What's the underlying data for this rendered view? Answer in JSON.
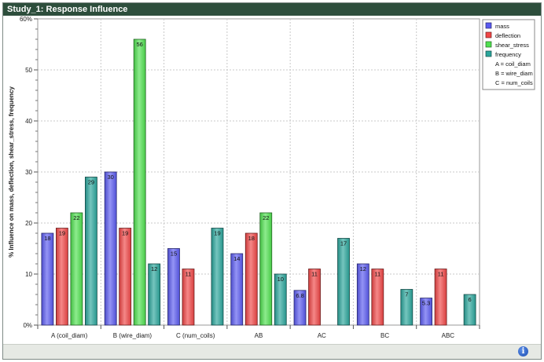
{
  "window": {
    "title": "Study_1: Response Influence"
  },
  "status": {
    "info_icon": "info-icon",
    "info_glyph": "i"
  },
  "chart_data": {
    "type": "bar",
    "title": "",
    "xlabel": "",
    "ylabel": "% Influence on mass, deflection, shear_stress, frequency",
    "ylim": [
      0,
      60
    ],
    "yticks": [
      "0%",
      "10",
      "20",
      "30",
      "40",
      "50",
      "60%"
    ],
    "yticks_values": [
      0,
      10,
      20,
      30,
      40,
      50,
      60
    ],
    "grid": true,
    "legend_position": "top-right",
    "categories": [
      "A (coil_diam)",
      "B (wire_diam)",
      "C (num_coils)",
      "AB",
      "AC",
      "BC",
      "ABC"
    ],
    "series": [
      {
        "name": "mass",
        "color": "#5a5af0",
        "values": [
          18,
          30,
          15,
          14,
          6.8,
          12,
          5.3
        ],
        "labels": [
          "18",
          "30",
          "15",
          "14",
          "6.8",
          "12",
          "5.3"
        ]
      },
      {
        "name": "deflection",
        "color": "#f04646",
        "values": [
          19,
          19,
          11,
          18,
          11,
          11,
          11
        ],
        "labels": [
          "19",
          "19",
          "11",
          "18",
          "11",
          "11",
          "11"
        ]
      },
      {
        "name": "shear_stress",
        "color": "#4fe04f",
        "values": [
          22,
          56,
          null,
          22,
          null,
          null,
          null
        ],
        "labels": [
          "22",
          "56",
          "",
          "22",
          "",
          "",
          ""
        ]
      },
      {
        "name": "frequency",
        "color": "#2aa59b",
        "values": [
          29,
          12,
          19,
          10,
          17,
          7,
          6
        ],
        "labels": [
          "29",
          "12",
          "19",
          "10",
          "17",
          "7",
          "6"
        ]
      }
    ],
    "legend_notes": [
      "A = coil_diam",
      "B = wire_diam",
      "C = num_coils"
    ]
  }
}
